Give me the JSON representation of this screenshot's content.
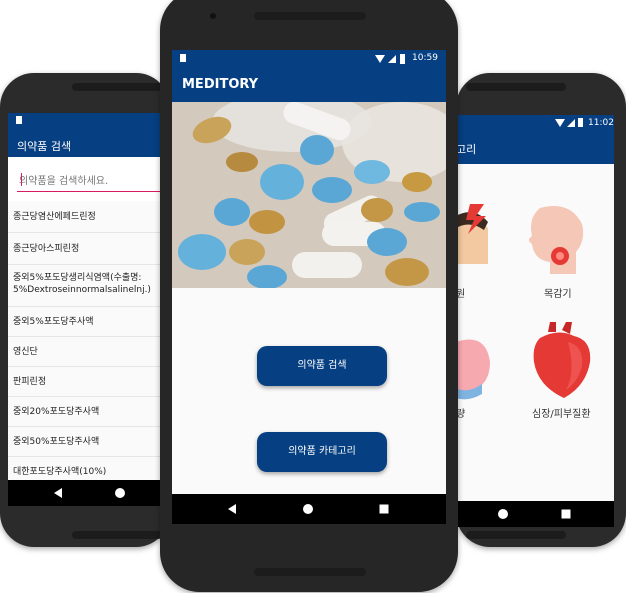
{
  "left_phone": {
    "app_title": "의약품 검색",
    "search": {
      "placeholder": "의약품을 검색하세요.",
      "value": ""
    },
    "items": [
      "종근당염산에페드린정",
      "종근당아스피린정",
      "중외5%포도당생리식염액(수출명: 5%Dextroseinnormalsalinelnj.)",
      "중외5%포도당주사액",
      "영신단",
      "판피린정",
      "중외20%포도당주사액",
      "중외50%포도당주사액",
      "대한포도당주사액(10%)"
    ]
  },
  "center_phone": {
    "status_time": "10:59",
    "app_title": "MEDITORY",
    "buttons": {
      "search_label": "의약품 검색",
      "category_label": "의약품 카테고리"
    }
  },
  "right_phone": {
    "status_time": "11:02",
    "app_title_partial": "고리",
    "categories": [
      {
        "label": "원"
      },
      {
        "label": "목감기"
      },
      {
        "label": "량"
      },
      {
        "label": "심장/피부질환"
      }
    ]
  },
  "colors": {
    "primary": "#063f82",
    "navbar": "#000000",
    "accent_pink": "#d81b60"
  }
}
